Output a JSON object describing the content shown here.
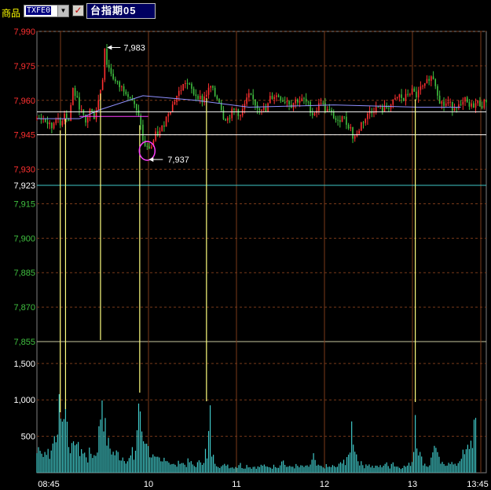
{
  "toolbar": {
    "product_label": "商品",
    "product_code": "TXFE0",
    "product_name": "台指期05",
    "checkbox_checked": true
  },
  "colors": {
    "background": "#000000",
    "grid_vertical": "#7a3a1a",
    "grid_horizontal": "#7a3a1a",
    "price_up": "#ff3030",
    "price_down": "#40c040",
    "price_axis_upper": "#ff3030",
    "price_axis_lower": "#40c040",
    "volume": "#40c8c8",
    "avg_line": "#9090ff",
    "reference_line": "#ffffff",
    "limit_line": "#40c8c8",
    "marker_vertical": "#ffff80",
    "circle": "#ff40ff"
  },
  "chart_data": {
    "type": "candlestick_with_volume",
    "time_labels": [
      "08:45",
      "10",
      "11",
      "12",
      "13",
      "13:45"
    ],
    "price_axis": {
      "ticks": [
        "7,990",
        "7,975",
        "7,960",
        "7,945",
        "7,930",
        "7,923",
        "7,915",
        "7,900",
        "7,885",
        "7,870",
        "7,855"
      ],
      "min": 7855,
      "max": 7990
    },
    "volume_axis": {
      "ticks": [
        "1,500",
        "1,000",
        "500"
      ],
      "min": 0,
      "max": 1800
    },
    "annotations": {
      "high": {
        "label": "7,983",
        "price": 7983
      },
      "low": {
        "label": "7,937",
        "price": 7937
      }
    },
    "reference_lines": [
      7955,
      7945
    ],
    "reference_price": 7923,
    "markers_minutes": [
      22,
      27,
      60,
      97,
      160,
      357
    ],
    "session_minutes": 300,
    "avg_path": [
      [
        0,
        7952
      ],
      [
        40,
        7952
      ],
      [
        60,
        7956
      ],
      [
        100,
        7962
      ],
      [
        150,
        7960
      ],
      [
        200,
        7957
      ],
      [
        280,
        7958
      ],
      [
        360,
        7957
      ],
      [
        400,
        7957
      ]
    ],
    "price_path": [
      [
        0,
        7952
      ],
      [
        6,
        7952
      ],
      [
        10,
        7950
      ],
      [
        14,
        7948
      ],
      [
        18,
        7953
      ],
      [
        22,
        7949
      ],
      [
        26,
        7955
      ],
      [
        30,
        7951
      ],
      [
        34,
        7965
      ],
      [
        38,
        7960
      ],
      [
        42,
        7955
      ],
      [
        46,
        7950
      ],
      [
        50,
        7956
      ],
      [
        54,
        7953
      ],
      [
        58,
        7960
      ],
      [
        62,
        7970
      ],
      [
        64,
        7983
      ],
      [
        66,
        7976
      ],
      [
        70,
        7972
      ],
      [
        74,
        7968
      ],
      [
        78,
        7966
      ],
      [
        82,
        7965
      ],
      [
        86,
        7963
      ],
      [
        90,
        7960
      ],
      [
        94,
        7955
      ],
      [
        98,
        7950
      ],
      [
        100,
        7942
      ],
      [
        104,
        7939
      ],
      [
        108,
        7940
      ],
      [
        112,
        7945
      ],
      [
        116,
        7946
      ],
      [
        120,
        7950
      ],
      [
        124,
        7955
      ],
      [
        128,
        7958
      ],
      [
        132,
        7962
      ],
      [
        136,
        7965
      ],
      [
        140,
        7968
      ],
      [
        144,
        7966
      ],
      [
        148,
        7963
      ],
      [
        152,
        7962
      ],
      [
        156,
        7960
      ],
      [
        160,
        7963
      ],
      [
        164,
        7966
      ],
      [
        168,
        7962
      ],
      [
        172,
        7960
      ],
      [
        176,
        7953
      ],
      [
        180,
        7952
      ],
      [
        184,
        7955
      ],
      [
        188,
        7956
      ],
      [
        192,
        7953
      ],
      [
        196,
        7958
      ],
      [
        200,
        7962
      ],
      [
        204,
        7960
      ],
      [
        208,
        7957
      ],
      [
        212,
        7957
      ],
      [
        216,
        7955
      ],
      [
        220,
        7961
      ],
      [
        224,
        7962
      ],
      [
        228,
        7962
      ],
      [
        232,
        7960
      ],
      [
        236,
        7960
      ],
      [
        240,
        7958
      ],
      [
        244,
        7960
      ],
      [
        248,
        7960
      ],
      [
        252,
        7960
      ],
      [
        256,
        7958
      ],
      [
        260,
        7954
      ],
      [
        264,
        7956
      ],
      [
        268,
        7960
      ],
      [
        272,
        7956
      ],
      [
        276,
        7955
      ],
      [
        280,
        7953
      ],
      [
        284,
        7950
      ],
      [
        288,
        7954
      ],
      [
        292,
        7950
      ],
      [
        296,
        7948
      ],
      [
        298,
        7944
      ],
      [
        302,
        7945
      ],
      [
        306,
        7950
      ],
      [
        310,
        7952
      ],
      [
        314,
        7955
      ],
      [
        318,
        7956
      ],
      [
        322,
        7957
      ],
      [
        326,
        7956
      ],
      [
        330,
        7957
      ],
      [
        334,
        7958
      ],
      [
        338,
        7960
      ],
      [
        342,
        7962
      ],
      [
        346,
        7960
      ],
      [
        350,
        7963
      ],
      [
        354,
        7964
      ],
      [
        358,
        7962
      ],
      [
        362,
        7965
      ],
      [
        366,
        7966
      ],
      [
        370,
        7970
      ],
      [
        374,
        7970
      ],
      [
        376,
        7967
      ],
      [
        380,
        7960
      ],
      [
        384,
        7958
      ],
      [
        388,
        7959
      ],
      [
        392,
        7957
      ],
      [
        396,
        7958
      ],
      [
        400,
        7957
      ],
      [
        404,
        7960
      ],
      [
        408,
        7957
      ],
      [
        412,
        7958
      ],
      [
        416,
        7959
      ],
      [
        420,
        7958
      ],
      [
        424,
        7960
      ]
    ],
    "volume_path": [
      [
        0,
        300
      ],
      [
        3,
        450
      ],
      [
        6,
        250
      ],
      [
        9,
        380
      ],
      [
        12,
        200
      ],
      [
        15,
        520
      ],
      [
        18,
        420
      ],
      [
        21,
        1200
      ],
      [
        22,
        1100
      ],
      [
        24,
        700
      ],
      [
        26,
        1180
      ],
      [
        28,
        880
      ],
      [
        30,
        500
      ],
      [
        32,
        400
      ],
      [
        34,
        300
      ],
      [
        36,
        560
      ],
      [
        38,
        420
      ],
      [
        40,
        300
      ],
      [
        42,
        380
      ],
      [
        44,
        250
      ],
      [
        46,
        300
      ],
      [
        48,
        200
      ],
      [
        50,
        320
      ],
      [
        52,
        280
      ],
      [
        54,
        260
      ],
      [
        56,
        300
      ],
      [
        58,
        500
      ],
      [
        60,
        900
      ],
      [
        61,
        1400
      ],
      [
        62,
        1050
      ],
      [
        64,
        700
      ],
      [
        66,
        500
      ],
      [
        68,
        400
      ],
      [
        70,
        350
      ],
      [
        72,
        300
      ],
      [
        74,
        280
      ],
      [
        76,
        300
      ],
      [
        78,
        250
      ],
      [
        80,
        220
      ],
      [
        82,
        260
      ],
      [
        84,
        200
      ],
      [
        86,
        180
      ],
      [
        88,
        220
      ],
      [
        90,
        300
      ],
      [
        92,
        200
      ],
      [
        94,
        500
      ],
      [
        96,
        1100
      ],
      [
        97,
        800
      ],
      [
        99,
        650
      ],
      [
        101,
        450
      ],
      [
        103,
        600
      ],
      [
        105,
        350
      ],
      [
        107,
        300
      ],
      [
        109,
        250
      ],
      [
        111,
        200
      ],
      [
        113,
        180
      ],
      [
        115,
        200
      ],
      [
        117,
        150
      ],
      [
        119,
        160
      ],
      [
        121,
        280
      ],
      [
        123,
        200
      ],
      [
        125,
        160
      ],
      [
        127,
        150
      ],
      [
        129,
        120
      ],
      [
        131,
        100
      ],
      [
        133,
        120
      ],
      [
        135,
        200
      ],
      [
        137,
        150
      ],
      [
        139,
        130
      ],
      [
        141,
        120
      ],
      [
        143,
        180
      ],
      [
        145,
        150
      ],
      [
        147,
        120
      ],
      [
        149,
        100
      ],
      [
        151,
        130
      ],
      [
        153,
        150
      ],
      [
        155,
        200
      ],
      [
        157,
        150
      ],
      [
        159,
        320
      ],
      [
        161,
        150
      ],
      [
        163,
        1000
      ],
      [
        165,
        300
      ],
      [
        167,
        200
      ],
      [
        169,
        150
      ],
      [
        171,
        120
      ],
      [
        173,
        100
      ],
      [
        175,
        90
      ],
      [
        177,
        110
      ],
      [
        179,
        150
      ],
      [
        181,
        100
      ],
      [
        183,
        90
      ],
      [
        185,
        80
      ],
      [
        187,
        100
      ],
      [
        189,
        90
      ],
      [
        191,
        150
      ],
      [
        193,
        100
      ],
      [
        195,
        80
      ],
      [
        197,
        100
      ],
      [
        199,
        120
      ],
      [
        201,
        90
      ],
      [
        203,
        80
      ],
      [
        205,
        100
      ],
      [
        207,
        90
      ],
      [
        209,
        80
      ],
      [
        211,
        100
      ],
      [
        213,
        120
      ],
      [
        215,
        90
      ],
      [
        217,
        80
      ],
      [
        219,
        100
      ],
      [
        221,
        80
      ],
      [
        223,
        90
      ],
      [
        225,
        120
      ],
      [
        227,
        100
      ],
      [
        229,
        90
      ],
      [
        231,
        250
      ],
      [
        233,
        150
      ],
      [
        235,
        100
      ],
      [
        237,
        90
      ],
      [
        239,
        80
      ],
      [
        241,
        100
      ],
      [
        243,
        90
      ],
      [
        245,
        110
      ],
      [
        247,
        80
      ],
      [
        249,
        90
      ],
      [
        251,
        100
      ],
      [
        253,
        80
      ],
      [
        255,
        90
      ],
      [
        257,
        100
      ],
      [
        259,
        150
      ],
      [
        261,
        250
      ],
      [
        263,
        120
      ],
      [
        265,
        90
      ],
      [
        267,
        100
      ],
      [
        269,
        80
      ],
      [
        271,
        90
      ],
      [
        273,
        100
      ],
      [
        275,
        80
      ],
      [
        277,
        90
      ],
      [
        279,
        100
      ],
      [
        281,
        80
      ],
      [
        283,
        90
      ],
      [
        285,
        110
      ],
      [
        287,
        150
      ],
      [
        289,
        250
      ],
      [
        291,
        120
      ],
      [
        293,
        200
      ],
      [
        295,
        300
      ],
      [
        297,
        700
      ],
      [
        299,
        500
      ],
      [
        301,
        300
      ],
      [
        303,
        200
      ],
      [
        305,
        150
      ],
      [
        307,
        120
      ],
      [
        309,
        100
      ],
      [
        311,
        150
      ],
      [
        313,
        120
      ],
      [
        315,
        100
      ],
      [
        317,
        90
      ],
      [
        319,
        80
      ],
      [
        321,
        100
      ],
      [
        323,
        90
      ],
      [
        325,
        100
      ],
      [
        327,
        120
      ],
      [
        329,
        150
      ],
      [
        331,
        100
      ],
      [
        333,
        90
      ],
      [
        335,
        200
      ],
      [
        337,
        120
      ],
      [
        339,
        100
      ],
      [
        341,
        90
      ],
      [
        343,
        80
      ],
      [
        345,
        100
      ],
      [
        347,
        90
      ],
      [
        349,
        100
      ],
      [
        351,
        120
      ],
      [
        353,
        150
      ],
      [
        355,
        200
      ],
      [
        357,
        950
      ],
      [
        359,
        400
      ],
      [
        361,
        300
      ],
      [
        363,
        200
      ],
      [
        365,
        150
      ],
      [
        367,
        120
      ],
      [
        369,
        100
      ],
      [
        371,
        150
      ],
      [
        373,
        250
      ],
      [
        375,
        500
      ],
      [
        377,
        300
      ],
      [
        379,
        200
      ],
      [
        381,
        150
      ],
      [
        383,
        120
      ],
      [
        385,
        100
      ],
      [
        387,
        150
      ],
      [
        389,
        200
      ],
      [
        391,
        150
      ],
      [
        393,
        120
      ],
      [
        395,
        100
      ],
      [
        397,
        150
      ],
      [
        399,
        200
      ],
      [
        401,
        300
      ],
      [
        403,
        250
      ],
      [
        405,
        300
      ],
      [
        407,
        400
      ],
      [
        409,
        450
      ],
      [
        411,
        500
      ],
      [
        413,
        780
      ],
      [
        415,
        500
      ]
    ]
  }
}
